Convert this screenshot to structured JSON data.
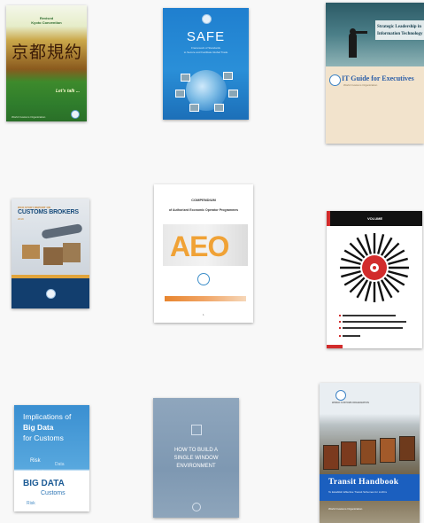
{
  "covers": [
    {
      "id": "kyoto",
      "title_line1": "Revised",
      "title_line2": "Kyoto Convention",
      "japanese": "京都規約",
      "tagline": "Let's talk ...",
      "footer": "World Customs Organization",
      "colors": {
        "primary": "#2f7d2c",
        "accent": "#cba84a"
      }
    },
    {
      "id": "safe",
      "title": "SAFE",
      "subtitle_line1": "Framework of Standards",
      "subtitle_line2": "to Secure and Facilitate Global Trade",
      "colors": {
        "primary": "#1f7fcf"
      }
    },
    {
      "id": "it-guide",
      "strap_line1": "Strategic Leadership in",
      "strap_line2": "Information Technology",
      "title": "IT Guide for Executives",
      "org": "World Customs Organization",
      "colors": {
        "primary": "#2b5ea8",
        "background": "#f2e3cc"
      }
    },
    {
      "id": "customs-brokers",
      "pre_title": "WCO STUDY REPORT ON",
      "title": "CUSTOMS BROKERS",
      "sub": "2019",
      "colors": {
        "primary": "#123e6e",
        "accent": "#e2a53c"
      }
    },
    {
      "id": "aeo",
      "title": "COMPENDIUM",
      "subtitle": "of Authorized Economic Operator Programmes",
      "image_text": "AEO",
      "page_note": "1",
      "colors": {
        "accent": "#f0a236"
      }
    },
    {
      "id": "volume",
      "header": "VOLUME",
      "colors": {
        "primary": "#111111",
        "accent": "#d22c2c"
      }
    },
    {
      "id": "big-data",
      "line1": "Implications of",
      "line2_bold": "Big Data",
      "line3": "for Customs",
      "cloud_words": [
        "Risk",
        "Data",
        "Analytics",
        "BIG DATA",
        "Customs",
        "Risk"
      ],
      "colors": {
        "primary": "#3a8fd1"
      }
    },
    {
      "id": "single-window",
      "line1": "HOW TO BUILD A",
      "line2": "SINGLE WINDOW",
      "line3": "ENVIRONMENT",
      "colors": {
        "primary": "#8fa6bd"
      }
    },
    {
      "id": "transit",
      "title": "Transit Handbook",
      "subtitle": "To Establish Effective Transit Schemes for LLDCs",
      "org": "World Customs Organization",
      "logo_text": "WORLD CUSTOMS ORGANIZATION",
      "colors": {
        "primary": "#1b5fbf"
      }
    }
  ]
}
